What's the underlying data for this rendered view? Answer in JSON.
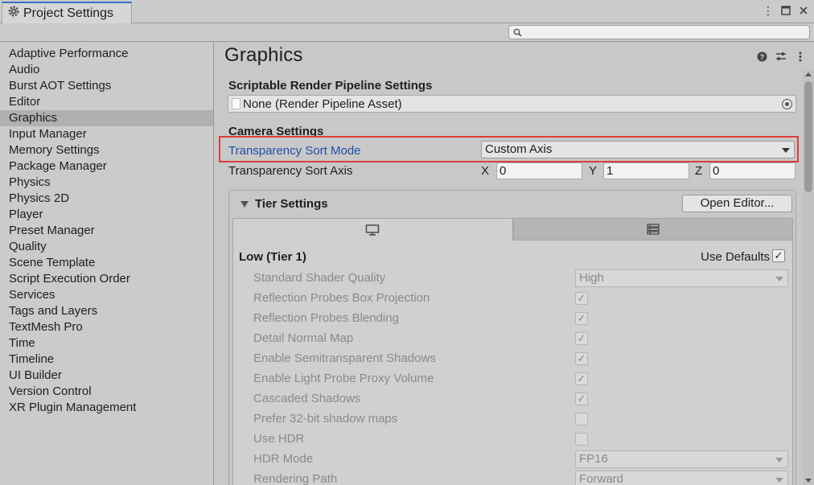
{
  "window": {
    "tab_title": "Project Settings",
    "icons": [
      "gear-icon",
      "more-vert-icon",
      "maximize-icon",
      "close-icon"
    ]
  },
  "search": {
    "placeholder": ""
  },
  "sidebar": {
    "items": [
      {
        "label": "Adaptive Performance"
      },
      {
        "label": "Audio"
      },
      {
        "label": "Burst AOT Settings"
      },
      {
        "label": "Editor"
      },
      {
        "label": "Graphics",
        "selected": true
      },
      {
        "label": "Input Manager"
      },
      {
        "label": "Memory Settings"
      },
      {
        "label": "Package Manager"
      },
      {
        "label": "Physics"
      },
      {
        "label": "Physics 2D"
      },
      {
        "label": "Player"
      },
      {
        "label": "Preset Manager"
      },
      {
        "label": "Quality"
      },
      {
        "label": "Scene Template"
      },
      {
        "label": "Script Execution Order"
      },
      {
        "label": "Services"
      },
      {
        "label": "Tags and Layers"
      },
      {
        "label": "TextMesh Pro"
      },
      {
        "label": "Time"
      },
      {
        "label": "Timeline"
      },
      {
        "label": "UI Builder"
      },
      {
        "label": "Version Control"
      },
      {
        "label": "XR Plugin Management"
      }
    ]
  },
  "main": {
    "title": "Graphics",
    "srp_section": "Scriptable Render Pipeline Settings",
    "srp_value": "None (Render Pipeline Asset)",
    "camera_section": "Camera Settings",
    "sort_mode_label": "Transparency Sort Mode",
    "sort_mode_value": "Custom Axis",
    "sort_axis_label": "Transparency Sort Axis",
    "axis": {
      "x_label": "X",
      "x": "0",
      "y_label": "Y",
      "y": "1",
      "z_label": "Z",
      "z": "0"
    },
    "highlight_color": "#e23b3b"
  },
  "tier": {
    "header": "Tier Settings",
    "open_editor": "Open Editor...",
    "tier_title": "Low (Tier 1)",
    "use_defaults_label": "Use Defaults",
    "use_defaults_checked": true,
    "props": {
      "shader_quality_label": "Standard Shader Quality",
      "shader_quality_value": "High",
      "box_projection": "Reflection Probes Box Projection",
      "blending": "Reflection Probes Blending",
      "detail_normal": "Detail Normal Map",
      "semi_shadows": "Enable Semitransparent Shadows",
      "lppv": "Enable Light Probe Proxy Volume",
      "cascaded": "Cascaded Shadows",
      "shadow32": "Prefer 32-bit shadow maps",
      "hdr": "Use HDR",
      "hdr_mode_label": "HDR Mode",
      "hdr_mode_value": "FP16",
      "render_path_label": "Rendering Path",
      "render_path_value": "Forward"
    }
  }
}
